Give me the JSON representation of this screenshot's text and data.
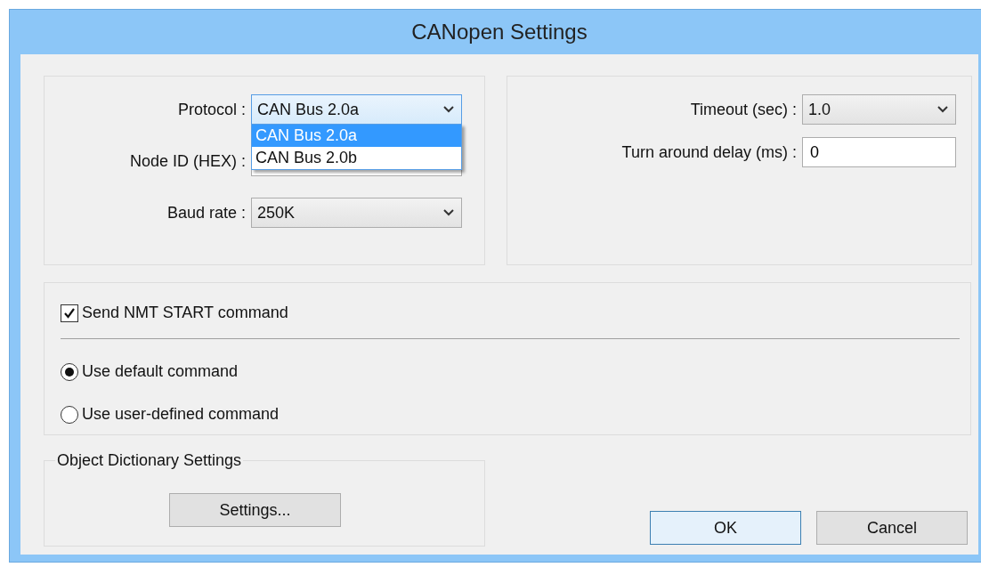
{
  "window": {
    "title": "CANopen Settings"
  },
  "connection": {
    "fields": [
      {
        "kind": "select",
        "label": "Protocol :",
        "value": "CAN Bus 2.0a",
        "expanded": true,
        "options": [
          {
            "label": "CAN Bus 2.0a",
            "selected": true
          },
          {
            "label": "CAN Bus 2.0b",
            "selected": false
          }
        ]
      },
      {
        "kind": "text",
        "label": "Node ID (HEX) :"
      },
      {
        "kind": "select",
        "label": "Baud rate :",
        "value": "250K",
        "expanded": false
      }
    ]
  },
  "timing": {
    "fields": [
      {
        "kind": "select",
        "label": "Timeout (sec) :",
        "value": "1.0",
        "expanded": false
      },
      {
        "kind": "text",
        "label": "Turn around delay (ms) :",
        "value": "0"
      }
    ]
  },
  "nmt": {
    "checkbox": {
      "label": "Send NMT START command",
      "checked": true
    },
    "radios": [
      {
        "label": "Use default command",
        "selected": true
      },
      {
        "label": "Use user-defined command",
        "selected": false
      }
    ]
  },
  "object_dictionary": {
    "legend": "Object Dictionary Settings",
    "button": "Settings..."
  },
  "buttons": [
    {
      "label": "OK",
      "default": true
    },
    {
      "label": "Cancel",
      "default": false
    }
  ]
}
